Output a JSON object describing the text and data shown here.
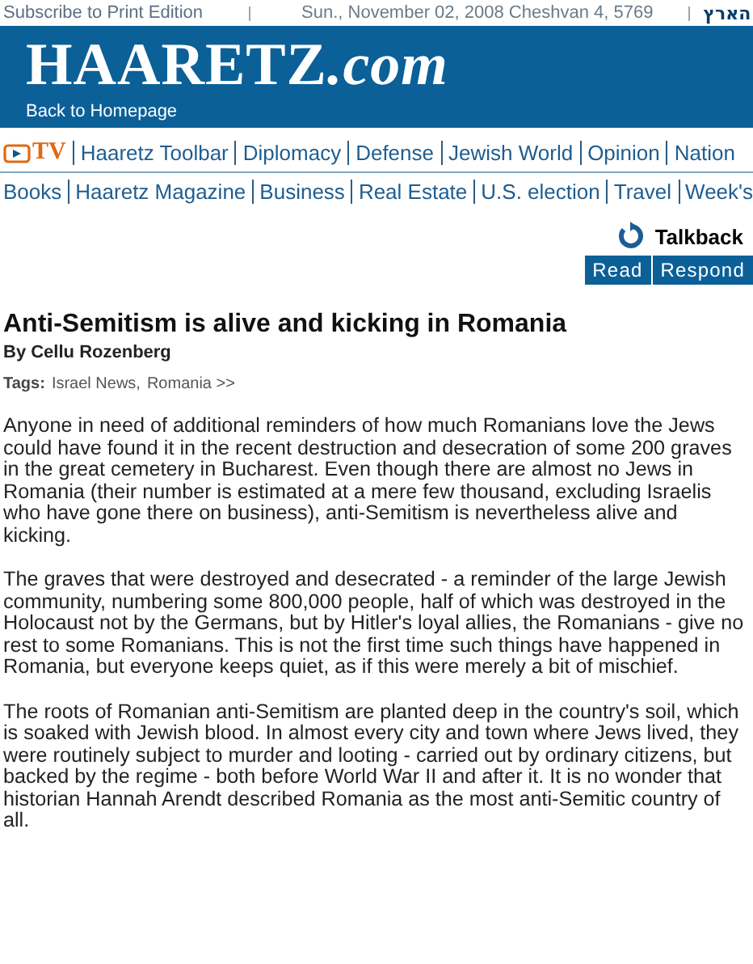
{
  "top_bar": {
    "subscribe": "Subscribe to Print Edition",
    "date": "Sun., November 02, 2008 Cheshvan 4, 5769",
    "hebrew_logo": "הארץ"
  },
  "header": {
    "logo": "HAARETZ",
    "logo_suffix": ".com",
    "back_link": "Back to Homepage"
  },
  "nav_rows": [
    {
      "items": [
        {
          "label": "TV",
          "kind": "tv"
        },
        {
          "label": "Haaretz Toolbar",
          "kind": "link"
        },
        {
          "label": "Diplomacy",
          "kind": "link"
        },
        {
          "label": "Defense",
          "kind": "link"
        },
        {
          "label": "Jewish World",
          "kind": "link"
        },
        {
          "label": "Opinion",
          "kind": "link"
        },
        {
          "label": "Nation",
          "kind": "link"
        }
      ]
    },
    {
      "items": [
        {
          "label": "Books",
          "kind": "link"
        },
        {
          "label": "Haaretz Magazine",
          "kind": "link"
        },
        {
          "label": "Business",
          "kind": "link"
        },
        {
          "label": "Real Estate",
          "kind": "link"
        },
        {
          "label": "U.S. election",
          "kind": "link"
        },
        {
          "label": "Travel",
          "kind": "link"
        },
        {
          "label": "Week's",
          "kind": "link"
        }
      ]
    }
  ],
  "talkback": {
    "title": "Talkback",
    "buttons": [
      "Read",
      "Respond"
    ]
  },
  "article": {
    "headline": "Anti-Semitism is alive and kicking in Romania",
    "byline": "By Cellu Rozenberg",
    "tags_label": "Tags:",
    "tags": [
      "Israel News,",
      "Romania >>"
    ],
    "paragraphs": [
      "Anyone in need of additional reminders of how much Romanians love the Jews could have found it in the recent destruction and desecration of some 200 graves in the great cemetery in Bucharest. Even though there are almost no Jews in Romania (their number is estimated at a mere few thousand, excluding Israelis who have gone there on business), anti-Semitism is nevertheless alive and kicking.",
      "The graves that were destroyed and desecrated - a reminder of the large Jewish community, numbering some 800,000 people, half of which was destroyed in the Holocaust not by the Germans, but by Hitler's loyal allies, the Romanians - give no rest to some Romanians. This is not the first time such things have happened in Romania, but everyone keeps quiet, as if this were merely a bit of mischief.",
      "The roots of Romanian anti-Semitism are planted deep in the country's soil, which is soaked with Jewish blood. In almost every city and town where Jews lived, they were routinely subject to murder and looting - carried out by ordinary citizens, but backed by the regime - both before World War II and after it. It is no wonder that historian Hannah Arendt described Romania as the most anti-Semitic country of all."
    ]
  }
}
